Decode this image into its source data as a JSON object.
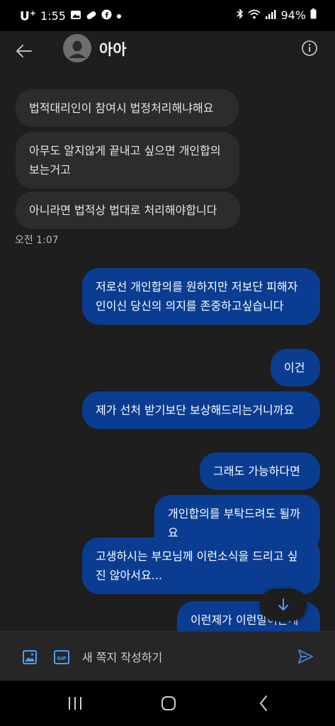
{
  "status_bar": {
    "carrier": "U",
    "carrier_sup": "+",
    "time": "1:55",
    "battery": "94%"
  },
  "header": {
    "title": "아아",
    "back_icon": "arrow-left-icon",
    "info_icon": "info-icon"
  },
  "messages": [
    {
      "dir": "in",
      "text": "법적대리인이 참여시 법정처리해냐해요"
    },
    {
      "dir": "in",
      "text": "아무도 알지않게 끝내고 싶으면 개인합의 보는거고"
    },
    {
      "dir": "in",
      "text": "아니라면 법적상 법대로 처리해야합니다"
    },
    {
      "dir": "out",
      "text": "저로선 개인합의를 원하지만 저보단 피해자인이신 당신의 의지를 존중하고싶습니다"
    },
    {
      "dir": "out",
      "text": "이건"
    },
    {
      "dir": "out",
      "text": "제가 선처 받기보단 보상해드리는거니까요"
    },
    {
      "dir": "out",
      "text": "그래도 가능하다면"
    },
    {
      "dir": "out",
      "text": "개인합의를 부탁드려도 될까요"
    },
    {
      "dir": "out",
      "text": "고생하시는 부모님께 이런소식을 드리고 싶진 않아서요..."
    },
    {
      "dir": "out",
      "text": "이런제가 이런말이는게"
    }
  ],
  "timestamp": "오전 1:07",
  "composer": {
    "placeholder": "새 쪽지 작성하기",
    "gif_label": "GIF"
  },
  "colors": {
    "outgoing_bubble": "#0a3d91",
    "incoming_bubble": "#2c2c2c",
    "background": "#1e1e1e",
    "accent_icon": "#4a9eff"
  }
}
